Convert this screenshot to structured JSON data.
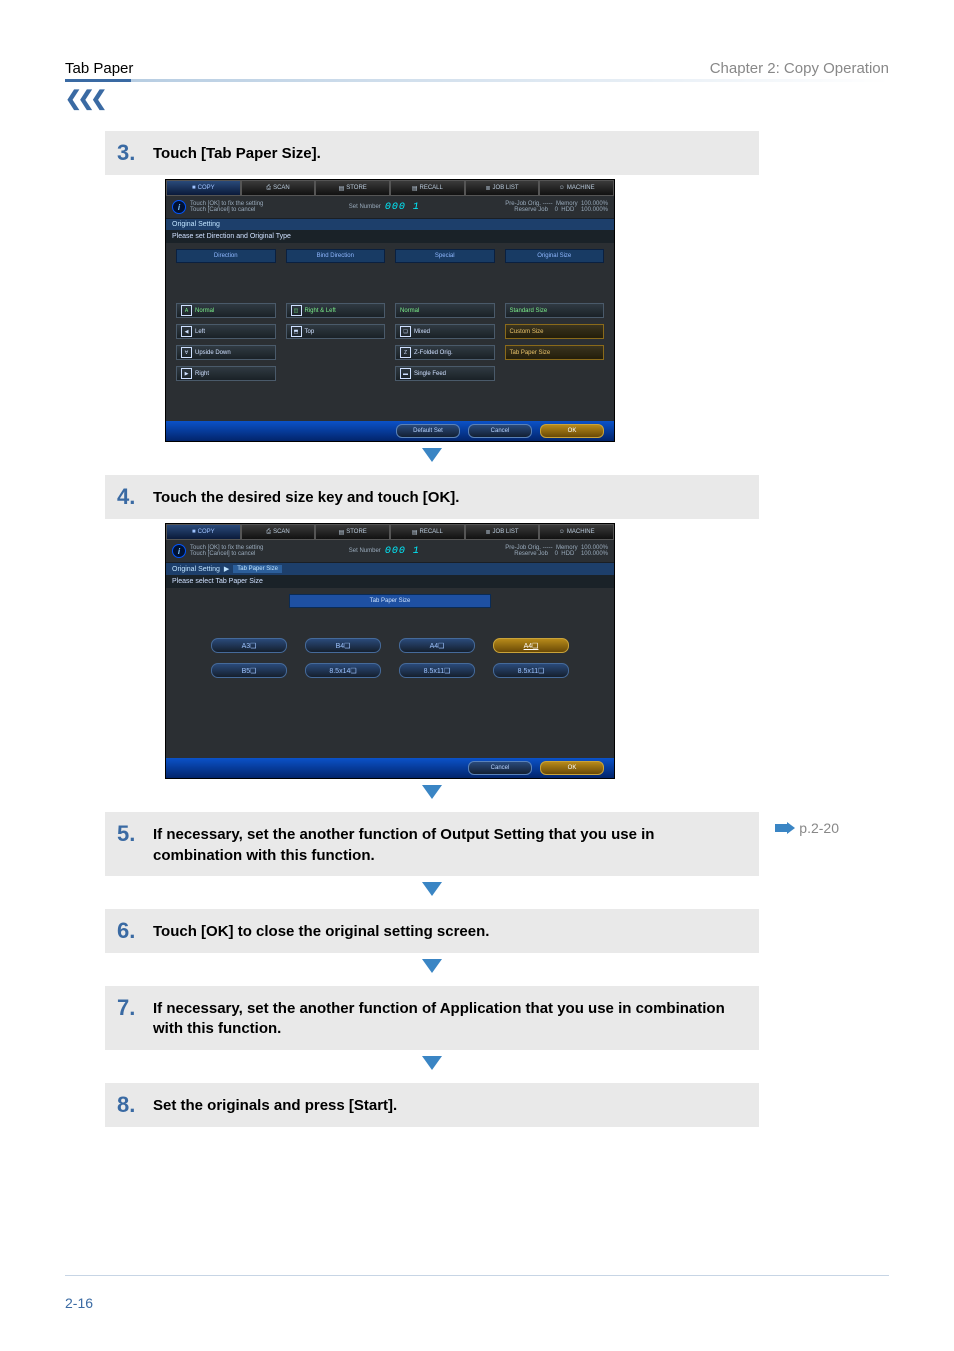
{
  "header": {
    "left": "Tab Paper",
    "right": "Chapter 2: Copy Operation"
  },
  "pageNumber": "2-16",
  "sideRef": "p.2-20",
  "steps": {
    "s3": {
      "num": "3.",
      "text": "Touch [Tab Paper Size]."
    },
    "s4": {
      "num": "4.",
      "text": "Touch the desired size key and touch [OK]."
    },
    "s5": {
      "num": "5.",
      "text": "If necessary, set the another function of Output Setting that you use in combination with this function."
    },
    "s6": {
      "num": "6.",
      "text": "Touch [OK] to close the original setting screen."
    },
    "s7": {
      "num": "7.",
      "text": "If necessary, set the another function of Application that you use in combination with this function."
    },
    "s8": {
      "num": "8.",
      "text": "Set the originals and press [Start]."
    }
  },
  "panel": {
    "tabs": {
      "copy": "COPY",
      "scan": "SCAN",
      "store": "STORE",
      "recall": "RECALL",
      "joblist": "JOB LIST",
      "machine": "MACHINE"
    },
    "infoLine1": "Touch [OK] to fix the setting",
    "infoLine2": "Touch [Cancel] to cancel",
    "setNumberLabel": "Set Number",
    "setNumberValue": "000 1",
    "status": {
      "l1a": "Pre-Job Orig.",
      "l1b": "-----",
      "l1c": "Memory",
      "l1d": "100.000%",
      "l2a": "Reserve Job",
      "l2b": "0",
      "l2c": "HDD",
      "l2d": "100.000%"
    },
    "crumb1": "Original Setting",
    "crumb2": "Tab Paper Size",
    "note1": "Please set Direction and Original Type",
    "note2": "Please select Tab Paper Size",
    "cols": {
      "direction": "Direction",
      "bind": "Bind Direction",
      "special": "Special",
      "origsize": "Original Size"
    },
    "direction": {
      "normal": "Normal",
      "left": "Left",
      "upside": "Upside Down",
      "right": "Right"
    },
    "bind": {
      "rl": "Right & Left",
      "top": "Top"
    },
    "special": {
      "normal": "Normal",
      "mixed": "Mixed",
      "zfold": "Z-Folded Orig.",
      "single": "Single Feed"
    },
    "origsize": {
      "std": "Standard Size",
      "custom": "Custom Size",
      "tab": "Tab Paper Size"
    },
    "sizeHeader": "Tab Paper Size",
    "sizes": {
      "a3": "A3❏",
      "b4": "B4❏",
      "a4": "A4❏",
      "a4p": "A4❏",
      "b5": "B5❏",
      "h85x14": "8.5x14❏",
      "h85x11": "8.5x11❏",
      "h85x11p": "8.5x11❏"
    },
    "footer": {
      "default": "Default Set",
      "cancel": "Cancel",
      "ok": "OK"
    }
  }
}
